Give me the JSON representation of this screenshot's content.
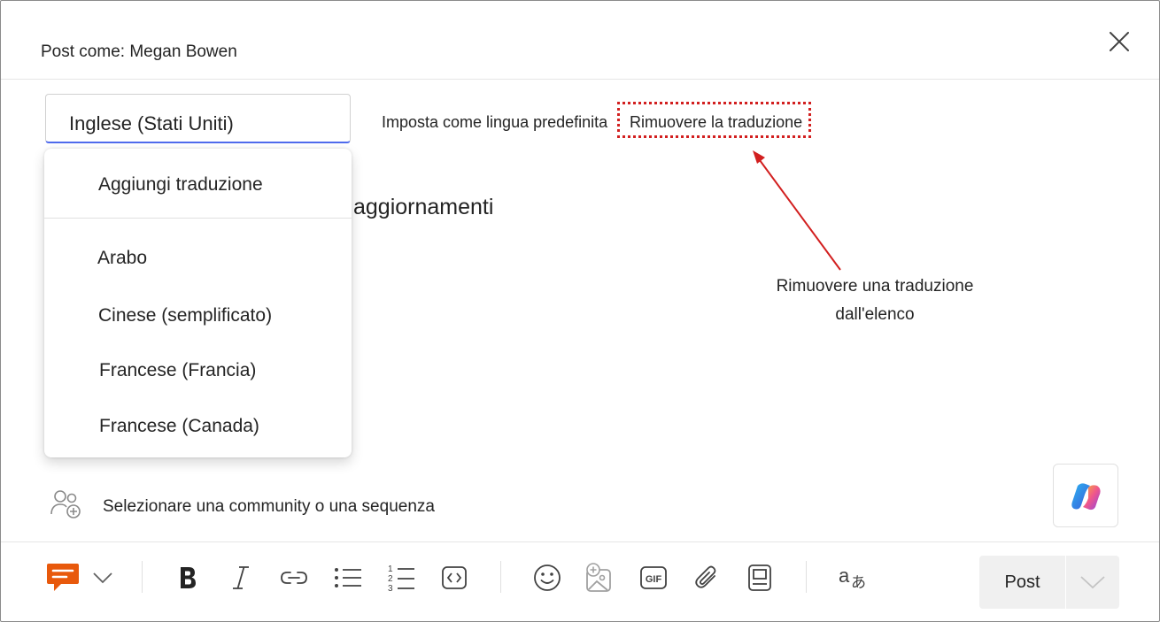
{
  "dialog": {
    "title": "Post come: Megan Bowen"
  },
  "language": {
    "selected": "Inglese (Stati Uniti)",
    "set_default_label": "Imposta come lingua predefinita",
    "remove_translation_label": "Rimuovere la traduzione"
  },
  "dropdown": {
    "add_translation_label": "Aggiungi traduzione",
    "items": [
      {
        "label": "Arabo"
      },
      {
        "label": "Cinese (semplificato)"
      },
      {
        "label": "Francese (Francia)"
      },
      {
        "label": "Francese (Canada)"
      }
    ]
  },
  "editor": {
    "visible_text": "aggiornamenti"
  },
  "annotation": {
    "callout_line1": "Rimuovere una traduzione",
    "callout_line2": "dall'elenco",
    "color": "#d21f1f"
  },
  "community": {
    "placeholder": "Selezionare una community o una sequenza"
  },
  "toolbar": {
    "post_label": "Post",
    "icons": [
      "message-type-icon",
      "chevron-down-icon",
      "bold-icon",
      "italic-icon",
      "link-icon",
      "bullet-list-icon",
      "numbered-list-icon",
      "code-icon",
      "emoji-icon",
      "image-icon",
      "gif-icon",
      "attach-icon",
      "article-icon",
      "translate-icon"
    ],
    "gif_label": "GIF"
  },
  "colors": {
    "accent": "#4f6bed",
    "message_type": "#e8590c"
  }
}
